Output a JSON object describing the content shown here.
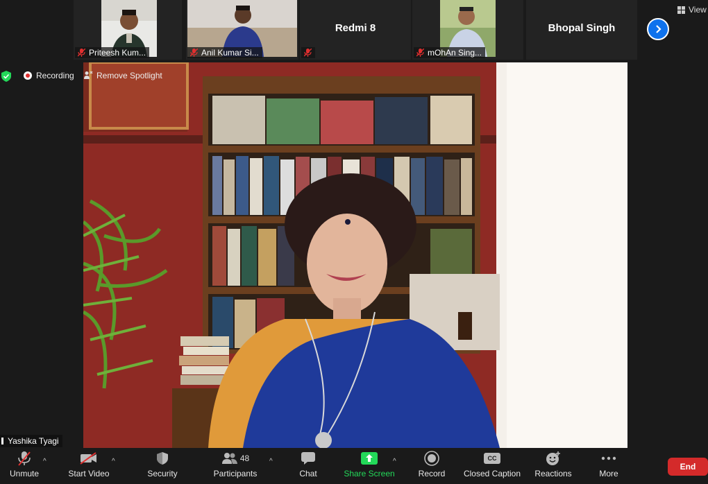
{
  "participants_strip": [
    {
      "name": "Priteesh Kum..."
    },
    {
      "name": "Anil Kumar Si..."
    },
    {
      "name": "Redmi 8"
    },
    {
      "name": "mOhAn Sing..."
    },
    {
      "name": "Bhopal Singh"
    }
  ],
  "view_label": "View",
  "status": {
    "recording": "Recording",
    "remove_spotlight": "Remove Spotlight"
  },
  "speaker": {
    "name": "Yashika Tyagi"
  },
  "toolbar": {
    "unmute": "Unmute",
    "start_video": "Start Video",
    "security": "Security",
    "participants": "Participants",
    "participants_count": "48",
    "chat": "Chat",
    "share_screen": "Share Screen",
    "record": "Record",
    "closed_caption": "Closed Caption",
    "cc_badge": "CC",
    "reactions": "Reactions",
    "more": "More",
    "end": "End"
  },
  "colors": {
    "share_green": "#23d959",
    "end_red": "#d42a2a",
    "accent_blue": "#0e72ed",
    "muted_red": "#e02f2f"
  }
}
